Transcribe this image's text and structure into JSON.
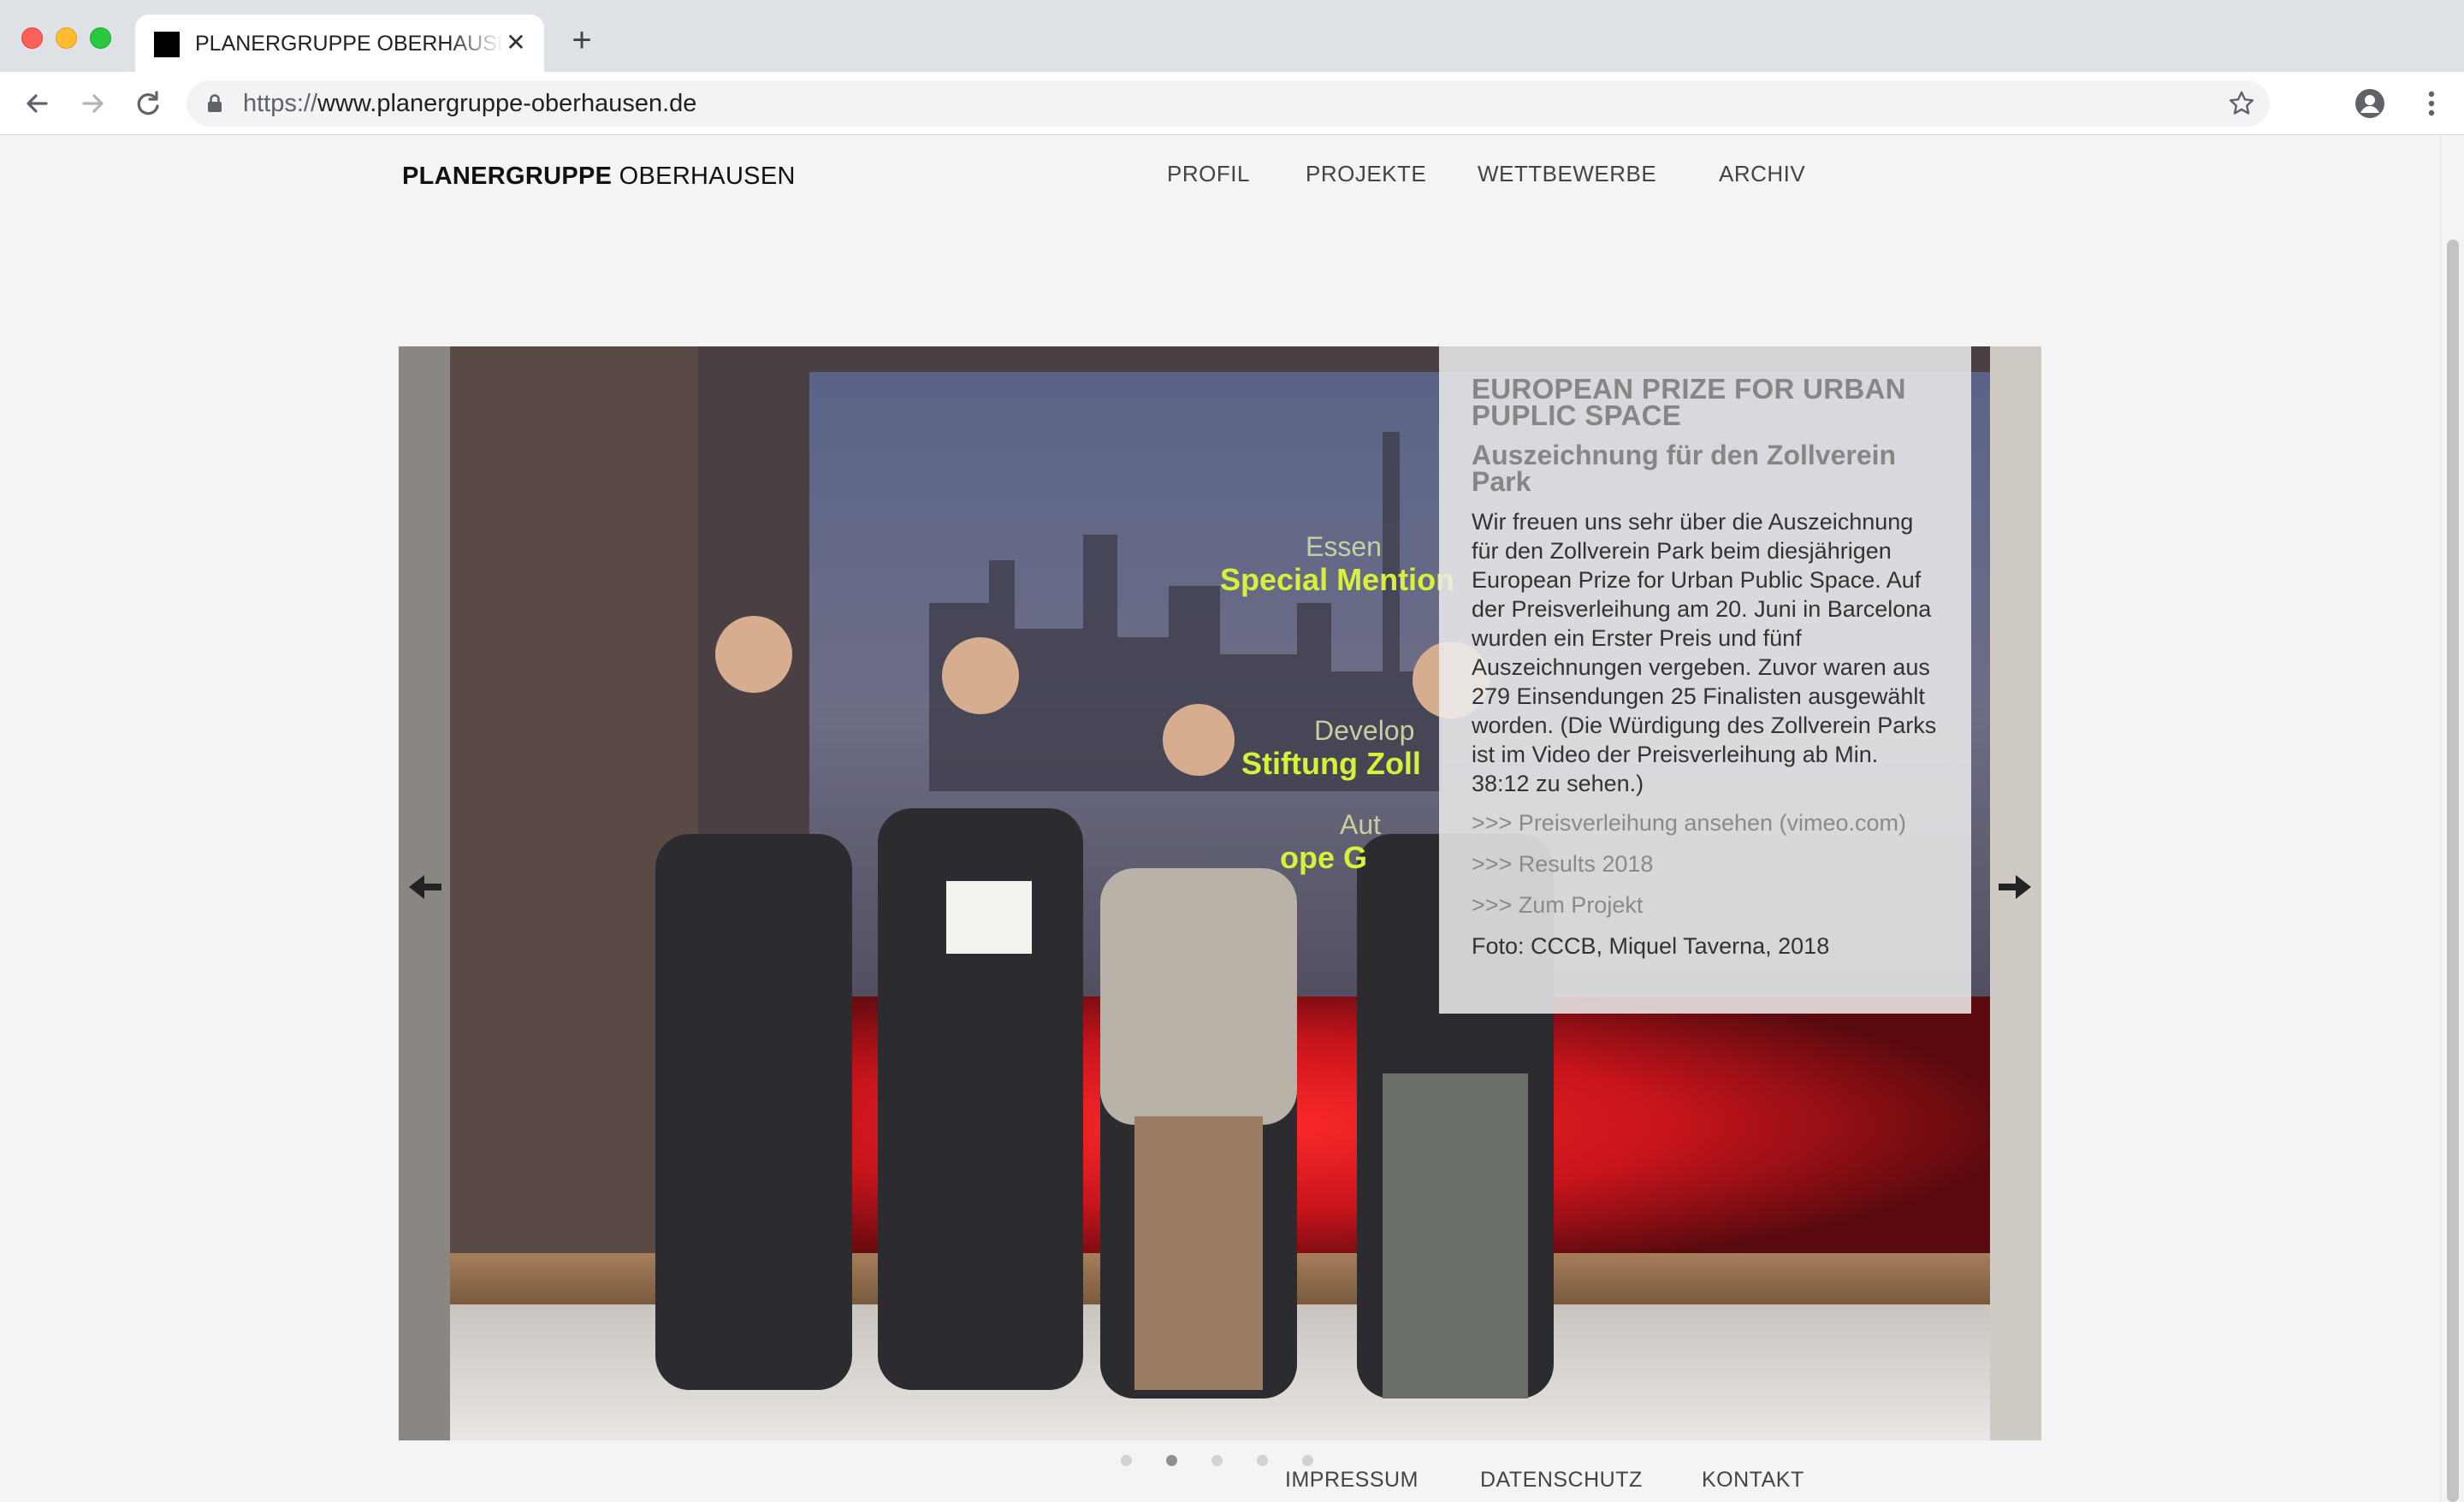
{
  "browser": {
    "tab_title": "PLANERGRUPPE OBERHAUSEN",
    "url_scheme": "https://",
    "url_host": "www.planergruppe-oberhausen.de"
  },
  "site": {
    "logo_bold": "PLANERGRUPPE",
    "logo_light": "OBERHAUSEN",
    "nav": {
      "profil": "PROFIL",
      "projekte": "PROJEKTE",
      "wettbewerbe": "WETTBEWERBE",
      "archiv": "ARCHIV"
    }
  },
  "slide": {
    "title": "EUROPEAN PRIZE FOR URBAN PUPLIC SPACE",
    "subtitle": "Auszeichnung für den Zollverein Park",
    "body": "Wir freuen uns sehr über die Auszeichnung für den Zollverein Park beim diesjährigen European Prize for Urban Public Space. Auf der Preisverleihung am 20. Juni in Bar­celona wurden ein Erster Preis und fünf Auszeichnungen vergeben. Zuvor waren aus 279 Einsendungen 25 Finalisten aus­gewählt worden. (Die Würdigung des Zoll­verein Parks ist im Video der Preisverlei­hung ab Min. 38:12 zu sehen.)",
    "link_video": ">>> Preisverleihung ansehen (vimeo.com)",
    "link_results": ">>> Results 2018",
    "link_project": ">>> Zum Projekt",
    "credit": "Foto: CCCB, Miquel Taverna, 2018",
    "screen_text": {
      "city": "Essen",
      "mention": "Special Mention",
      "developer": "Develop",
      "foundation": "Stiftung Zoll",
      "author": "Aut",
      "office": "ope G"
    },
    "dot_count": 5,
    "active_dot": 2
  },
  "footer": {
    "impressum": "IMPRESSUM",
    "datenschutz": "DATENSCHUTZ",
    "kontakt": "KONTAKT"
  },
  "colors": {
    "page_bg": "#f4f4f4",
    "overlay_heading": "#868686",
    "stage_red": "#c8141b",
    "screen_yellow": "#d9f03a"
  }
}
